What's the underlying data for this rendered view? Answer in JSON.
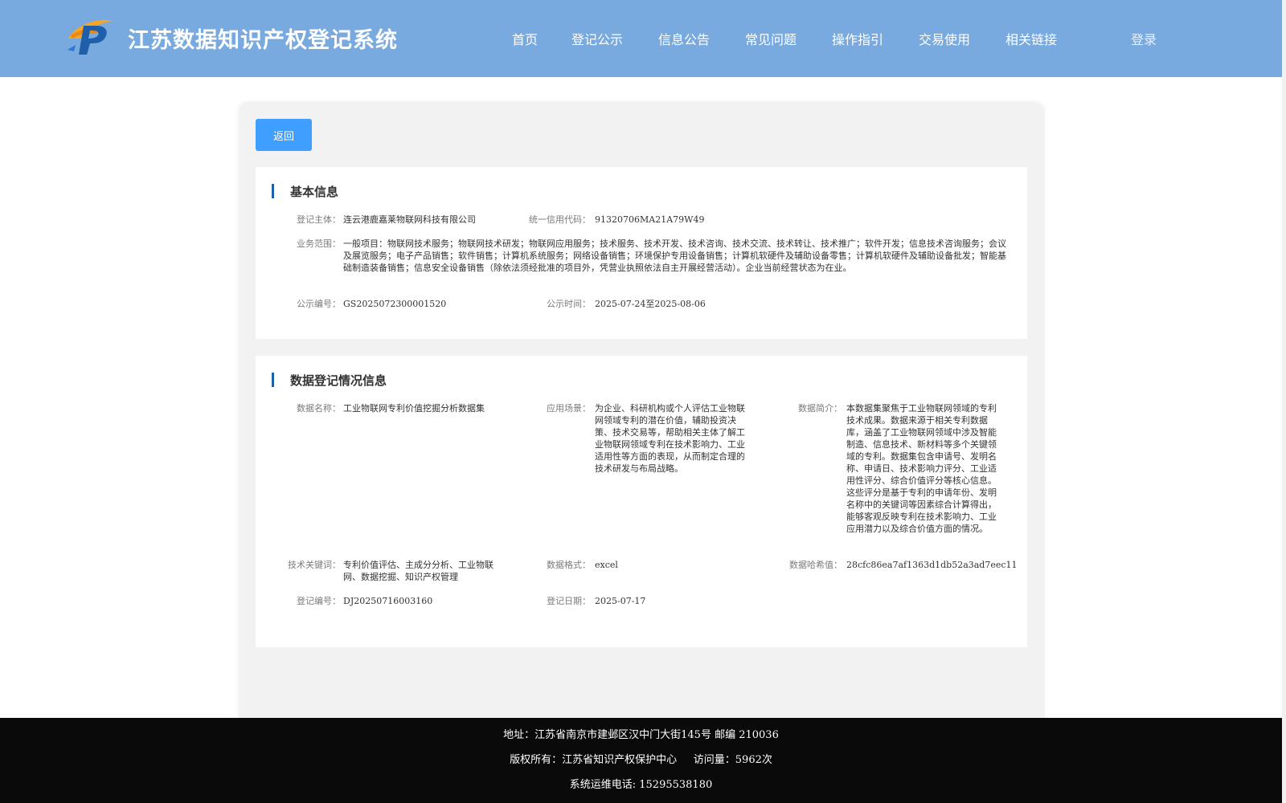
{
  "header": {
    "title": "江苏数据知识产权登记系统",
    "nav": [
      "首页",
      "登记公示",
      "信息公告",
      "常见问题",
      "操作指引",
      "交易使用",
      "相关链接"
    ],
    "login": "登录"
  },
  "back_button": "返回",
  "basic_info": {
    "section_title": "基本信息",
    "subject_label": "登记主体：",
    "subject_value": "连云港鹿嘉莱物联网科技有限公司",
    "credit_label": "统一信用代码：",
    "credit_value": "91320706MA21A79W49",
    "scope_label": "业务范围：",
    "scope_value": "一般项目：物联网技术服务；物联网技术研发；物联网应用服务；技术服务、技术开发、技术咨询、技术交流、技术转让、技术推广；软件开发；信息技术咨询服务；会议及展览服务；电子产品销售；软件销售；计算机系统服务；网络设备销售；环境保护专用设备销售；计算机软硬件及辅助设备零售；计算机软硬件及辅助设备批发；智能基础制造装备销售；信息安全设备销售（除依法须经批准的项目外，凭营业执照依法自主开展经营活动）。企业当前经营状态为在业。",
    "notice_no_label": "公示编号：",
    "notice_no_value": "GS2025072300001520",
    "notice_time_label": "公示时间：",
    "notice_time_value": "2025-07-24至2025-08-06"
  },
  "data_info": {
    "section_title": "数据登记情况信息",
    "name_label": "数据名称：",
    "name_value": "工业物联网专利价值挖掘分析数据集",
    "scene_label": "应用场景：",
    "scene_value": "为企业、科研机构或个人评估工业物联网领域专利的潜在价值，辅助投资决策、技术交易等，帮助相关主体了解工业物联网领域专利在技术影响力、工业适用性等方面的表现，从而制定合理的技术研发与布局战略。",
    "intro_label": "数据简介：",
    "intro_value": "本数据集聚焦于工业物联网领域的专利技术成果。数据来源于相关专利数据库，涵盖了工业物联网领域中涉及智能制造、信息技术、新材料等多个关键领域的专利。数据集包含申请号、发明名称、申请日、技术影响力评分、工业适用性评分、综合价值评分等核心信息。这些评分是基于专利的申请年份、发明名称中的关键词等因素综合计算得出，能够客观反映专利在技术影响力、工业应用潜力以及综合价值方面的情况。",
    "keywords_label": "技术关键词：",
    "keywords_value": "专利价值评估、主成分分析、工业物联网、数据挖掘、知识产权管理",
    "format_label": "数据格式：",
    "format_value": "excel",
    "hash_label": "数据哈希值：",
    "hash_value": "28cfc86ea7af1363d1db52a3ad7eec11",
    "reg_no_label": "登记编号：",
    "reg_no_value": "DJ20250716003160",
    "reg_date_label": "登记日期：",
    "reg_date_value": "2025-07-17"
  },
  "footer": {
    "address": "地址：江苏省南京市建邺区汉中门大街145号 邮编 210036",
    "copyright": "版权所有：江苏省知识产权保护中心     访问量：5962次",
    "phone": "系统运维电话: 15295538180"
  },
  "colors": {
    "header_bg": "#78aadf",
    "button_bg": "#409eff",
    "section_bar": "#1f5ea8",
    "footer_bg": "#0a0a0a"
  }
}
